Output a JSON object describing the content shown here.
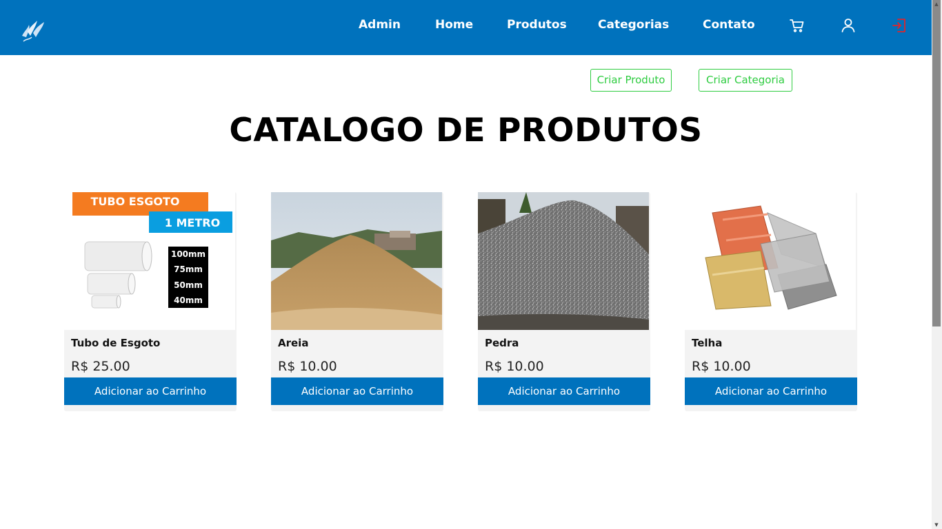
{
  "nav": {
    "items": [
      "Admin",
      "Home",
      "Produtos",
      "Categorias",
      "Contato"
    ],
    "icons": [
      "cart-icon",
      "user-icon",
      "logout-icon"
    ]
  },
  "admin_actions": {
    "create_product": "Criar Produto",
    "create_category": "Criar Categoria"
  },
  "page_title": "CATALOGO DE PRODUTOS",
  "products": [
    {
      "name": "Tubo de Esgoto",
      "price": "R$ 25.00",
      "button": "Adicionar ao Carrinho",
      "image_text": {
        "banner": "TUBO ESGOTO",
        "sub_banner": "1 METRO",
        "sizes": [
          "100mm",
          "75mm",
          "50mm",
          "40mm"
        ]
      }
    },
    {
      "name": "Areia",
      "price": "R$ 10.00",
      "button": "Adicionar ao Carrinho"
    },
    {
      "name": "Pedra",
      "price": "R$ 10.00",
      "button": "Adicionar ao Carrinho"
    },
    {
      "name": "Telha",
      "price": "R$ 10.00",
      "button": "Adicionar ao Carrinho"
    }
  ],
  "colors": {
    "primary": "#0072bd",
    "outline_green": "#2ecc40",
    "logout_red": "#e0252a",
    "card_bg": "#f3f3f3"
  }
}
